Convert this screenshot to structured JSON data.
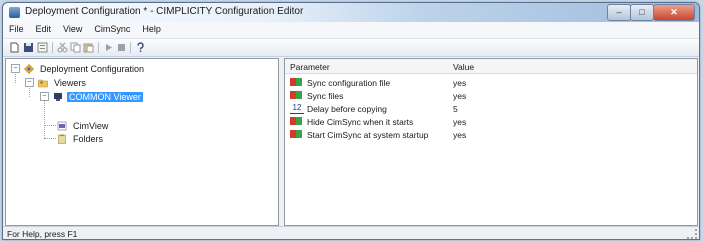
{
  "window": {
    "title": "Deployment Configuration * - CIMPLICITY Configuration Editor"
  },
  "menu": [
    "File",
    "Edit",
    "View",
    "CimSync",
    "Help"
  ],
  "toolbar": {
    "icons": [
      "new-icon",
      "save-icon",
      "properties-icon",
      "cut-icon",
      "copy-icon",
      "paste-icon",
      "play-icon",
      "stop-icon",
      "help-icon"
    ]
  },
  "tree": {
    "root": "Deployment Configuration",
    "viewers": "Viewers",
    "common_viewer": "COMMON Viewer",
    "cimview": "CimView",
    "folders": "Folders"
  },
  "grid": {
    "headers": {
      "parameter": "Parameter",
      "value": "Value"
    },
    "rows": [
      {
        "icon": "bool-icon",
        "parameter": "Sync configuration file",
        "value": "yes"
      },
      {
        "icon": "bool-icon",
        "parameter": "Sync files",
        "value": "yes"
      },
      {
        "icon": "number-icon",
        "icon_text": "12",
        "parameter": "Delay before copying",
        "value": "5"
      },
      {
        "icon": "bool-icon",
        "parameter": "Hide CimSync when it starts",
        "value": "yes"
      },
      {
        "icon": "bool-icon",
        "parameter": "Start CimSync at system startup",
        "value": "yes"
      }
    ]
  },
  "status": {
    "text": "For Help, press F1"
  },
  "colors": {
    "selection": "#3399ff",
    "bool_icon_red": "#d43a2a",
    "bool_icon_green": "#3aa34a"
  }
}
